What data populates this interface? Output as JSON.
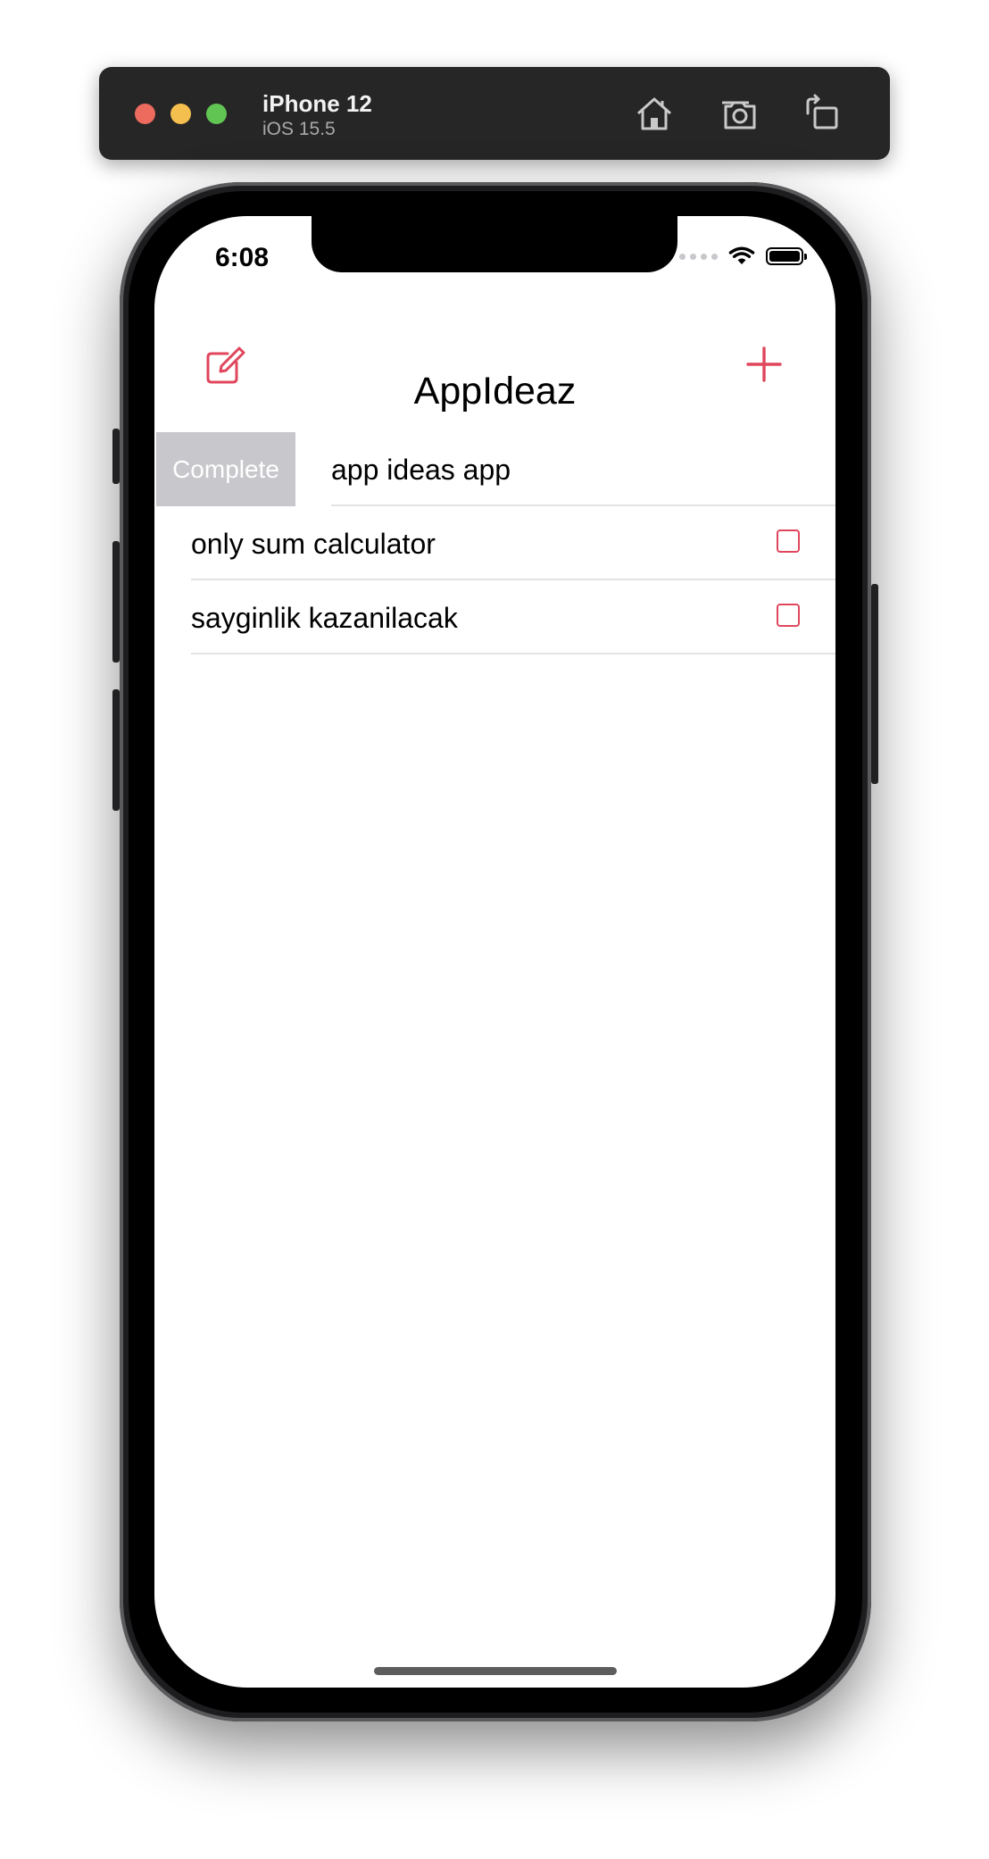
{
  "simulator": {
    "device_name": "iPhone 12",
    "os_version": "iOS 15.5",
    "icons": [
      "home-icon",
      "screenshot-icon",
      "rotate-icon"
    ]
  },
  "status_bar": {
    "time": "6:08"
  },
  "nav": {
    "title": "AppIdeaz",
    "accent_color": "#e0475d"
  },
  "list": {
    "swiped_row": {
      "action_label": "Complete",
      "label": "app ideas app"
    },
    "rows": [
      {
        "label": "only sum calculator",
        "checked": false
      },
      {
        "label": "sayginlik kazanilacak",
        "checked": false
      }
    ]
  }
}
